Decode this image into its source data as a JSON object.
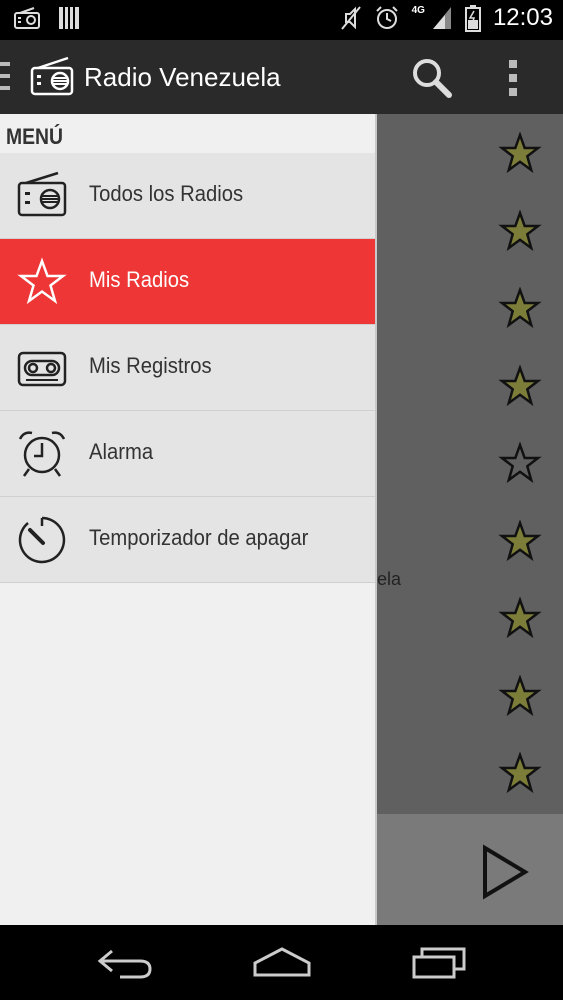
{
  "status_bar": {
    "time": "12:03",
    "network_label": "4G",
    "icons": [
      "radio-notification-icon",
      "barcode-notification-icon",
      "mute-icon",
      "alarm-icon",
      "signal-icon",
      "battery-icon"
    ]
  },
  "action_bar": {
    "title": "Radio Venezuela",
    "icons": [
      "hamburger-icon",
      "radio-logo-icon",
      "search-icon",
      "overflow-menu-icon"
    ]
  },
  "drawer": {
    "header": "MENÚ",
    "items": [
      {
        "label": "Todos los Radios",
        "icon": "radio-icon",
        "active": false
      },
      {
        "label": "Mis Radios",
        "icon": "star-icon",
        "active": true
      },
      {
        "label": "Mis Registros",
        "icon": "cassette-icon",
        "active": false
      },
      {
        "label": "Alarma",
        "icon": "alarm-clock-icon",
        "active": false
      },
      {
        "label": "Temporizador de apagar",
        "icon": "timer-icon",
        "active": false
      }
    ]
  },
  "background_list": {
    "partial_text": "ela",
    "favorites": [
      true,
      true,
      true,
      true,
      false,
      true,
      true,
      true,
      true
    ]
  },
  "player": {
    "icon": "play-icon"
  },
  "nav_bar": {
    "icons": [
      "back-icon",
      "home-icon",
      "recents-icon"
    ]
  },
  "colors": {
    "accent": "#ee3636",
    "action_bar": "#2a2a2a",
    "drawer_bg": "#f0f0f0",
    "star_fill": "#7d7d3a"
  }
}
